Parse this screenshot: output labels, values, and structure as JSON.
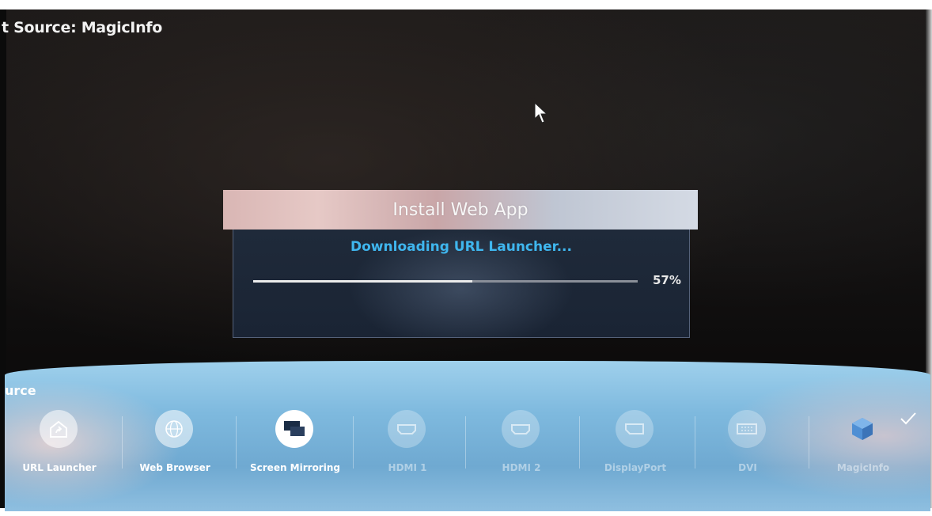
{
  "screen": {
    "title": "t Source: MagicInfo"
  },
  "dialog": {
    "title": "Install Web App",
    "status": "Downloading URL Launcher...",
    "progress_fraction": 0.57,
    "progress_text": "57%"
  },
  "source_bar": {
    "label": "urce",
    "items": [
      {
        "name": "URL Launcher",
        "icon": "url-launcher-icon"
      },
      {
        "name": "Web Browser",
        "icon": "web-browser-icon"
      },
      {
        "name": "Screen Mirroring",
        "icon": "screen-mirroring-icon"
      },
      {
        "name": "HDMI 1",
        "icon": "hdmi-icon"
      },
      {
        "name": "HDMI 2",
        "icon": "hdmi-icon"
      },
      {
        "name": "DisplayPort",
        "icon": "displayport-icon"
      },
      {
        "name": "DVI",
        "icon": "dvi-icon"
      },
      {
        "name": "MagicInfo",
        "icon": "magicinfo-icon"
      }
    ]
  },
  "colors": {
    "status_text": "#3fb6ee",
    "source_bar": "#7eb9de"
  }
}
